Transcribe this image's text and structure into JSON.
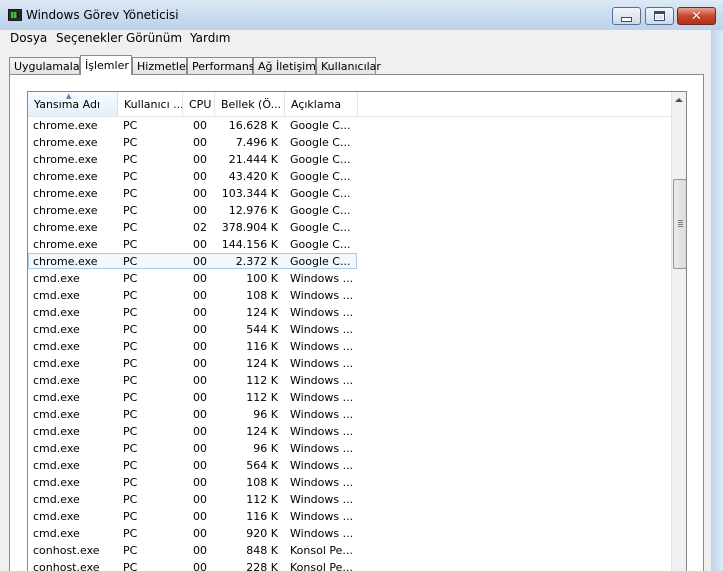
{
  "window": {
    "title": "Windows Görev Yöneticisi"
  },
  "menu": [
    "Dosya",
    "Seçenekler",
    "Görünüm",
    "Yardım"
  ],
  "tabs": [
    "Uygulamalar",
    "İşlemler",
    "Hizmetler",
    "Performans",
    "Ağ İletişimi",
    "Kullanıcılar"
  ],
  "active_tab": "İşlemler",
  "columns": [
    "Yansıma Adı",
    "Kullanıcı ...",
    "CPU",
    "Bellek (Ö...",
    "Açıklama"
  ],
  "sorted_column": "Yansıma Adı",
  "processes": [
    {
      "name": "chrome.exe",
      "user": "PC",
      "cpu": "00",
      "mem": "16.628 K",
      "desc": "Google C..."
    },
    {
      "name": "chrome.exe",
      "user": "PC",
      "cpu": "00",
      "mem": "7.496 K",
      "desc": "Google C..."
    },
    {
      "name": "chrome.exe",
      "user": "PC",
      "cpu": "00",
      "mem": "21.444 K",
      "desc": "Google C..."
    },
    {
      "name": "chrome.exe",
      "user": "PC",
      "cpu": "00",
      "mem": "43.420 K",
      "desc": "Google C..."
    },
    {
      "name": "chrome.exe",
      "user": "PC",
      "cpu": "00",
      "mem": "103.344 K",
      "desc": "Google C..."
    },
    {
      "name": "chrome.exe",
      "user": "PC",
      "cpu": "00",
      "mem": "12.976 K",
      "desc": "Google C..."
    },
    {
      "name": "chrome.exe",
      "user": "PC",
      "cpu": "02",
      "mem": "378.904 K",
      "desc": "Google C..."
    },
    {
      "name": "chrome.exe",
      "user": "PC",
      "cpu": "00",
      "mem": "144.156 K",
      "desc": "Google C..."
    },
    {
      "name": "chrome.exe",
      "user": "PC",
      "cpu": "00",
      "mem": "2.372 K",
      "desc": "Google C...",
      "selected": true
    },
    {
      "name": "cmd.exe",
      "user": "PC",
      "cpu": "00",
      "mem": "100 K",
      "desc": "Windows ..."
    },
    {
      "name": "cmd.exe",
      "user": "PC",
      "cpu": "00",
      "mem": "108 K",
      "desc": "Windows ..."
    },
    {
      "name": "cmd.exe",
      "user": "PC",
      "cpu": "00",
      "mem": "124 K",
      "desc": "Windows ..."
    },
    {
      "name": "cmd.exe",
      "user": "PC",
      "cpu": "00",
      "mem": "544 K",
      "desc": "Windows ..."
    },
    {
      "name": "cmd.exe",
      "user": "PC",
      "cpu": "00",
      "mem": "116 K",
      "desc": "Windows ..."
    },
    {
      "name": "cmd.exe",
      "user": "PC",
      "cpu": "00",
      "mem": "124 K",
      "desc": "Windows ..."
    },
    {
      "name": "cmd.exe",
      "user": "PC",
      "cpu": "00",
      "mem": "112 K",
      "desc": "Windows ..."
    },
    {
      "name": "cmd.exe",
      "user": "PC",
      "cpu": "00",
      "mem": "112 K",
      "desc": "Windows ..."
    },
    {
      "name": "cmd.exe",
      "user": "PC",
      "cpu": "00",
      "mem": "96 K",
      "desc": "Windows ..."
    },
    {
      "name": "cmd.exe",
      "user": "PC",
      "cpu": "00",
      "mem": "124 K",
      "desc": "Windows ..."
    },
    {
      "name": "cmd.exe",
      "user": "PC",
      "cpu": "00",
      "mem": "96 K",
      "desc": "Windows ..."
    },
    {
      "name": "cmd.exe",
      "user": "PC",
      "cpu": "00",
      "mem": "564 K",
      "desc": "Windows ..."
    },
    {
      "name": "cmd.exe",
      "user": "PC",
      "cpu": "00",
      "mem": "108 K",
      "desc": "Windows ..."
    },
    {
      "name": "cmd.exe",
      "user": "PC",
      "cpu": "00",
      "mem": "112 K",
      "desc": "Windows ..."
    },
    {
      "name": "cmd.exe",
      "user": "PC",
      "cpu": "00",
      "mem": "116 K",
      "desc": "Windows ..."
    },
    {
      "name": "cmd.exe",
      "user": "PC",
      "cpu": "00",
      "mem": "920 K",
      "desc": "Windows ..."
    },
    {
      "name": "conhost.exe",
      "user": "PC",
      "cpu": "00",
      "mem": "848 K",
      "desc": "Konsol Pe..."
    },
    {
      "name": "conhost.exe",
      "user": "PC",
      "cpu": "00",
      "mem": "228 K",
      "desc": "Konsol Pe..."
    }
  ],
  "icons": {
    "app": "task-manager-icon",
    "minimize": "minimize-icon",
    "maximize": "maximize-icon",
    "close": "close-icon",
    "sort": "sort-ascending-icon",
    "scroll_up": "scroll-up-arrow-icon"
  }
}
